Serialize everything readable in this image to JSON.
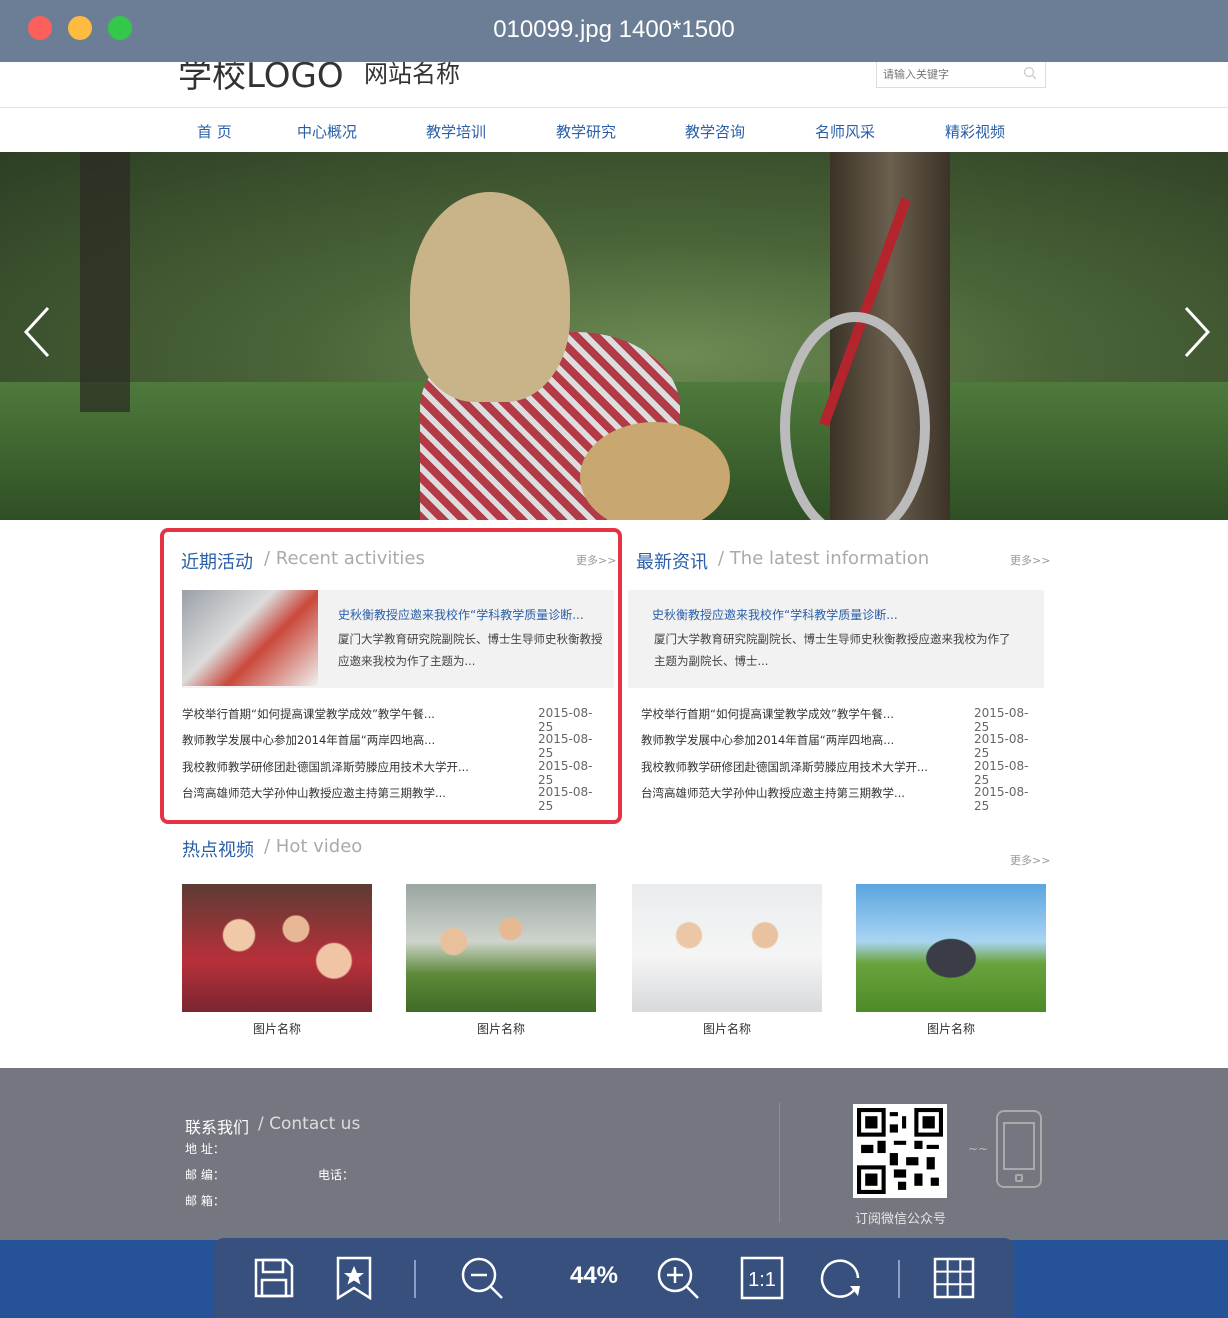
{
  "window": {
    "title": "010099.jpg  1400*1500"
  },
  "header": {
    "logo": "学校LOGO",
    "site_name": "网站名称",
    "search_placeholder": "请输入关键字"
  },
  "nav": [
    "首  页",
    "中心概况",
    "教学培训",
    "教学研究",
    "教学咨询",
    "名师风采",
    "精彩视频"
  ],
  "recent": {
    "title": "近期活动",
    "subtitle": "/ Recent activities",
    "more": "更多>>",
    "feature_title": "史秋衡教授应邀来我校作“学科教学质量诊断...",
    "feature_desc_1": "厦门大学教育研究院副院长、博士生导师史秋衡教授",
    "feature_desc_2": "应邀来我校为作了主题为...",
    "items": [
      {
        "text": "学校举行首期“如何提高课堂教学成效”教学午餐...",
        "date": "2015-08-25"
      },
      {
        "text": "教师教学发展中心参加2014年首届“两岸四地高...",
        "date": "2015-08-25"
      },
      {
        "text": "我校教师教学研修团赴德国凯泽斯劳滕应用技术大学开...",
        "date": "2015-08-25"
      },
      {
        "text": "台湾高雄师范大学孙仲山教授应邀主持第三期教学...",
        "date": "2015-08-25"
      }
    ]
  },
  "latest": {
    "title": "最新资讯",
    "subtitle": "/ The latest information",
    "more": "更多>>",
    "feature_title": "史秋衡教授应邀来我校作“学科教学质量诊断...",
    "feature_desc_1": "厦门大学教育研究院副院长、博士生导师史秋衡教授应邀来我校为作了",
    "feature_desc_2": "主题为副院长、博士...",
    "items": [
      {
        "text": "学校举行首期“如何提高课堂教学成效”教学午餐...",
        "date": "2015-08-25"
      },
      {
        "text": "教师教学发展中心参加2014年首届“两岸四地高...",
        "date": "2015-08-25"
      },
      {
        "text": "我校教师教学研修团赴德国凯泽斯劳滕应用技术大学开...",
        "date": "2015-08-25"
      },
      {
        "text": "台湾高雄师范大学孙仲山教授应邀主持第三期教学...",
        "date": "2015-08-25"
      }
    ]
  },
  "video": {
    "title": "热点视频",
    "subtitle": "/ Hot video",
    "more": "更多>>",
    "captions": [
      "图片名称",
      "图片名称",
      "图片名称",
      "图片名称"
    ]
  },
  "footer": {
    "title": "联系我们",
    "subtitle": "/ Contact us",
    "address_label": "地      址：",
    "postcode_label": "邮      编：",
    "phone_label": "电话：",
    "email_label": "邮      箱：",
    "qr_caption": "订阅微信公众号"
  },
  "toolbar": {
    "zoom": "44%"
  },
  "colors": {
    "accent": "#2a5fa8",
    "highlight": "#e53346",
    "toolbar": "#37507e",
    "footer": "#74777f"
  }
}
